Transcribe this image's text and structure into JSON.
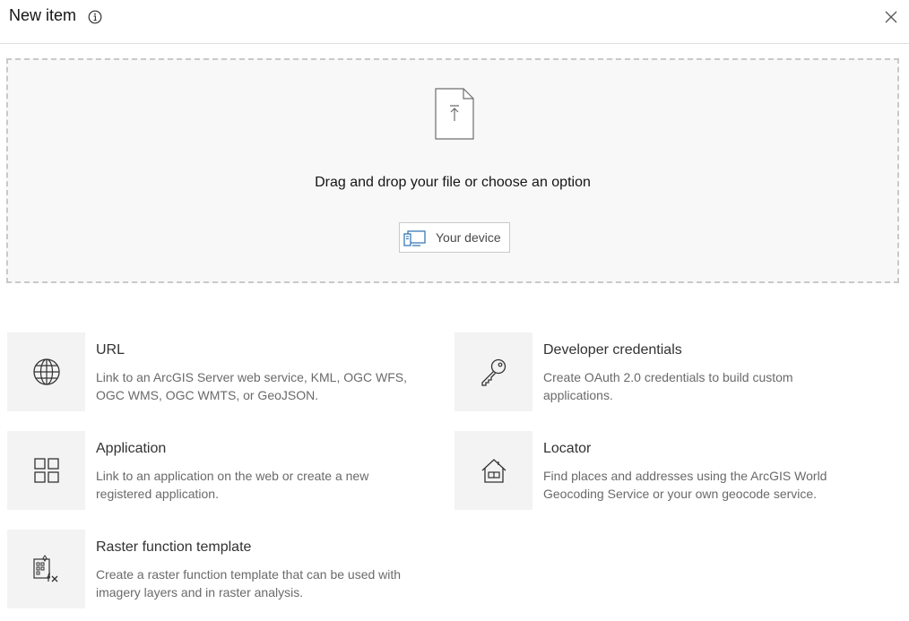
{
  "header": {
    "title": "New item",
    "info_icon": "info-icon",
    "close_icon": "close-icon"
  },
  "dropzone": {
    "icon": "file-upload-icon",
    "text": "Drag and drop your file or choose an option",
    "device_button": {
      "icon": "device-icon",
      "label": "Your device"
    }
  },
  "options": [
    {
      "icon": "globe-icon",
      "title": "URL",
      "description": "Link to an ArcGIS Server web service, KML, OGC WFS, OGC WMS, OGC WMTS, or GeoJSON."
    },
    {
      "icon": "key-icon",
      "title": "Developer credentials",
      "description": "Create OAuth 2.0 credentials to build custom applications."
    },
    {
      "icon": "apps-grid-icon",
      "title": "Application",
      "description": "Link to an application on the web or create a new registered application."
    },
    {
      "icon": "house-icon",
      "title": "Locator",
      "description": "Find places and addresses using the ArcGIS World Geocoding Service or your own geocode service."
    },
    {
      "icon": "raster-function-icon",
      "title": "Raster function template",
      "description": "Create a raster function template that can be used with imagery layers and in raster analysis."
    }
  ]
}
